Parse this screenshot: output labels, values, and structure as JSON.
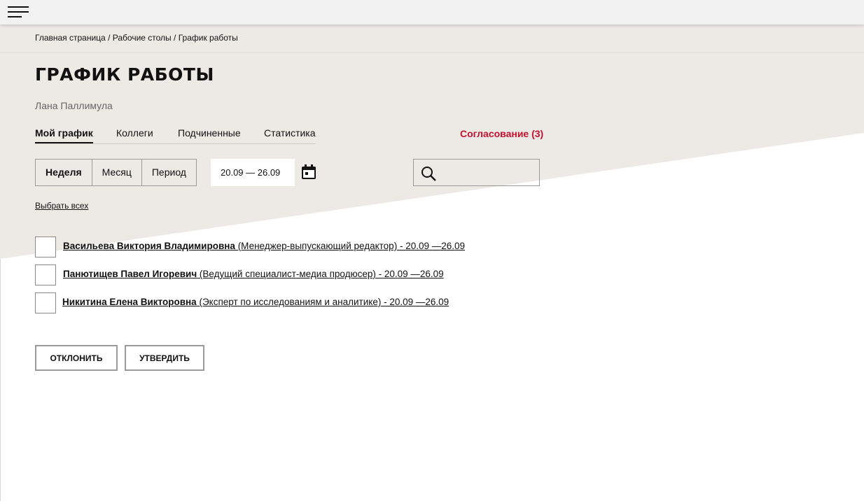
{
  "breadcrumb": {
    "home": "Главная страница",
    "desks": "Рабочие столы",
    "current": "График работы",
    "separator": " / "
  },
  "page": {
    "title": "ГРАФИК РАБОТЫ",
    "user_name": "Лана Паллимула"
  },
  "tabs": [
    {
      "label": "Мой график",
      "active": true
    },
    {
      "label": "Коллеги",
      "active": false
    },
    {
      "label": "Подчиненные",
      "active": false
    },
    {
      "label": "Статистика",
      "active": false
    }
  ],
  "approval_link": "Согласование (3)",
  "period_switch": [
    {
      "label": "Неделя",
      "active": true
    },
    {
      "label": "Месяц",
      "active": false
    },
    {
      "label": "Период",
      "active": false
    }
  ],
  "date_range": "20.09 — 26.09",
  "search": {
    "value": "",
    "placeholder": ""
  },
  "select_all": "Выбрать всех",
  "employees": [
    {
      "name": "Васильева Виктория Владимировна",
      "details": " (Менеджер-выпускающий редактор) - 20.09 —26.09",
      "checked": false
    },
    {
      "name": "Панютищев Павел Игоревич",
      "details": " (Ведущий специалист-медиа продюсер) - 20.09 —26.09",
      "checked": false
    },
    {
      "name": "Никитина Елена Викторовна",
      "details": " (Эксперт по исследованиям и аналитике) - 20.09 —26.09",
      "checked": false
    }
  ],
  "actions": {
    "reject": "ОТКЛОНИТЬ",
    "approve": "УТВЕРДИТЬ"
  },
  "colors": {
    "accent": "#c8102e",
    "background_band": "#edeae6",
    "topbar": "#f2f2f2"
  },
  "icons": {
    "menu": "hamburger-menu-icon",
    "calendar": "calendar-icon",
    "search": "search-icon"
  }
}
